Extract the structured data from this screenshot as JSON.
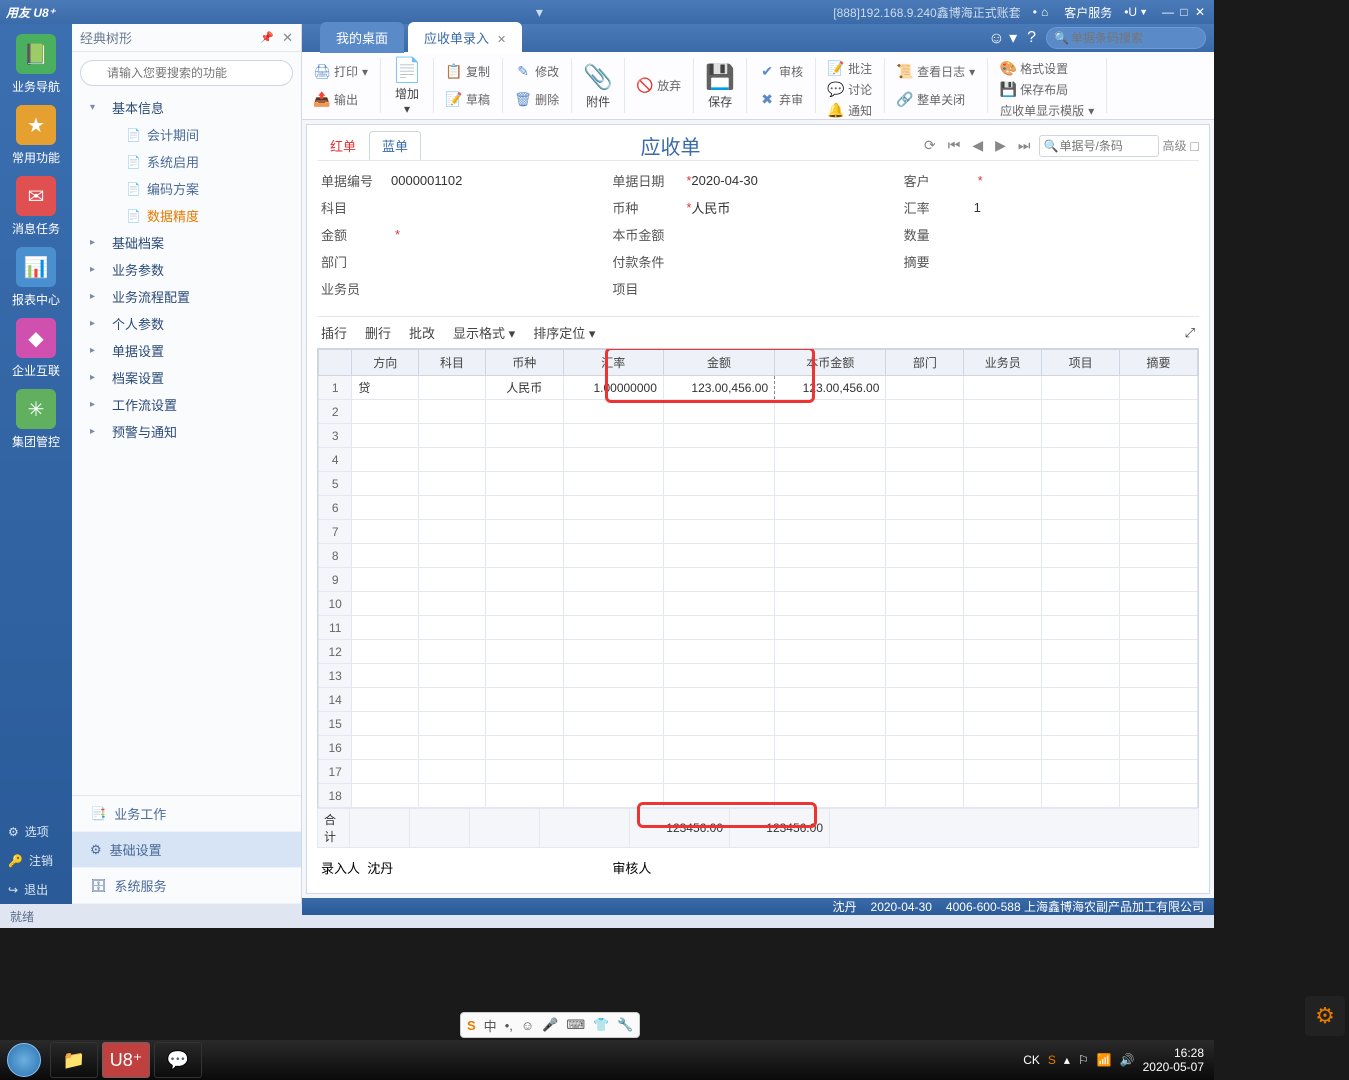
{
  "title": {
    "app": "用友 U8⁺",
    "server": "[888]192.168.9.240鑫博海正式账套",
    "service": "客户服务",
    "u": "U"
  },
  "leftrail": [
    {
      "label": "业务导航",
      "icon": "📗",
      "bg": "#4ab060"
    },
    {
      "label": "常用功能",
      "icon": "★",
      "bg": "#e6a030"
    },
    {
      "label": "消息任务",
      "icon": "✉",
      "bg": "#e05050"
    },
    {
      "label": "报表中心",
      "icon": "📊",
      "bg": "#4a90d0"
    },
    {
      "label": "企业互联",
      "icon": "◆",
      "bg": "#d050b0"
    },
    {
      "label": "集团管控",
      "icon": "✳",
      "bg": "#60b060"
    }
  ],
  "leftbot": [
    {
      "icon": "⚙",
      "label": "选项"
    },
    {
      "icon": "🔑",
      "label": "注销"
    },
    {
      "icon": "↪",
      "label": "退出"
    }
  ],
  "nav": {
    "title": "经典树形",
    "search_ph": "请输入您要搜索的功能",
    "items": [
      {
        "type": "parent",
        "label": "基本信息",
        "open": true
      },
      {
        "type": "child",
        "label": "会计期间"
      },
      {
        "type": "child",
        "label": "系统启用"
      },
      {
        "type": "child",
        "label": "编码方案"
      },
      {
        "type": "child",
        "label": "数据精度",
        "active": true
      },
      {
        "type": "parent",
        "label": "基础档案"
      },
      {
        "type": "parent",
        "label": "业务参数"
      },
      {
        "type": "parent",
        "label": "业务流程配置"
      },
      {
        "type": "parent",
        "label": "个人参数"
      },
      {
        "type": "parent",
        "label": "单据设置"
      },
      {
        "type": "parent",
        "label": "档案设置"
      },
      {
        "type": "parent",
        "label": "工作流设置"
      },
      {
        "type": "parent",
        "label": "预警与通知"
      }
    ],
    "bottom": [
      {
        "icon": "📑",
        "label": "业务工作"
      },
      {
        "icon": "⚙",
        "label": "基础设置",
        "active": true
      },
      {
        "icon": "🗄",
        "label": "系统服务"
      }
    ]
  },
  "tabs": {
    "home": "我的桌面",
    "cur": "应收单录入"
  },
  "topsearch_ph": "单据条码搜索",
  "ribbon": {
    "print": "打印",
    "export": "输出",
    "add": "增加",
    "copy": "复制",
    "draft": "草稿",
    "modify": "修改",
    "delete": "删除",
    "attach": "附件",
    "discard": "放弃",
    "save": "保存",
    "audit": "审核",
    "deaudit": "弃审",
    "batch": "批注",
    "discuss": "讨论",
    "notify": "通知",
    "log": "查看日志",
    "close": "整单关闭",
    "fmt": "格式设置",
    "layout": "保存布局",
    "tpl": "应收单显示模版"
  },
  "bill": {
    "redtab": "红单",
    "bluetab": "蓝单",
    "title": "应收单",
    "nav_ph": "单据号/条码",
    "adv": "高级",
    "fields": {
      "no_l": "单据编号",
      "no": "0000001102",
      "date_l": "单据日期",
      "date": "2020-04-30",
      "cust_l": "客户",
      "subj_l": "科目",
      "curr_l": "币种",
      "curr": "人民币",
      "rate_l": "汇率",
      "rate": "1",
      "amt_l": "金额",
      "lamt_l": "本币金额",
      "qty_l": "数量",
      "dept_l": "部门",
      "pay_l": "付款条件",
      "memo_l": "摘要",
      "sales_l": "业务员",
      "proj_l": "项目"
    },
    "gridbtns": {
      "ins": "插行",
      "del": "删行",
      "batch": "批改",
      "fmt": "显示格式",
      "sort": "排序定位"
    },
    "cols": [
      "方向",
      "科目",
      "币种",
      "汇率",
      "金额",
      "本币金额",
      "部门",
      "业务员",
      "项目",
      "摘要"
    ],
    "row": {
      "dir": "贷",
      "curr": "人民币",
      "rate": "1.00000000",
      "amt": "123.00,456.00",
      "lamt": "123.00,456.00"
    },
    "sum_l": "合计",
    "sum_amt": "123456.00",
    "sum_lamt": "123456.00",
    "enter_l": "录入人",
    "enter": "沈丹",
    "audit_l": "审核人"
  },
  "status": {
    "ready": "就绪",
    "user": "沈丹",
    "sdate": "2020-04-30",
    "tel": "4006-600-588 上海鑫博海农副产品加工有限公司"
  },
  "ime": {
    "text": "中"
  },
  "tray": {
    "ck": "CK",
    "time": "16:28",
    "date": "2020-05-07"
  }
}
